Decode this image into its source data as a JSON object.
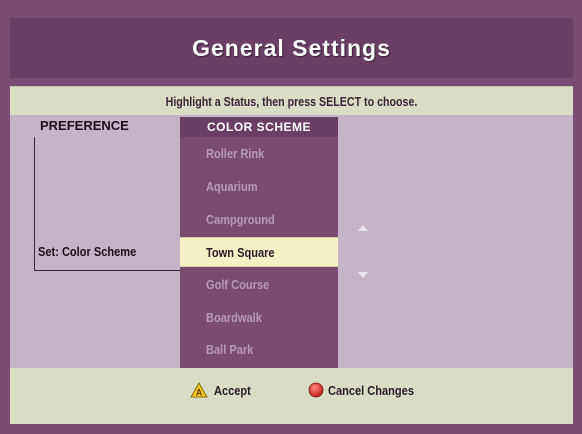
{
  "window": {
    "title": "General Settings",
    "instruction": "Highlight a Status, then press SELECT to choose."
  },
  "header": {
    "preference_label": "PREFERENCE",
    "column_label": "COLOR SCHEME"
  },
  "setting": {
    "label": "Set: Color Scheme"
  },
  "options": [
    {
      "label": "Roller Rink",
      "selected": false
    },
    {
      "label": "Aquarium",
      "selected": false
    },
    {
      "label": "Campground",
      "selected": false
    },
    {
      "label": "Town Square",
      "selected": true
    },
    {
      "label": "Golf Course",
      "selected": false
    },
    {
      "label": "Boardwalk",
      "selected": false
    },
    {
      "label": "Ball Park",
      "selected": false
    }
  ],
  "footer": {
    "accept_label": "Accept",
    "cancel_label": "Cancel Changes",
    "accept_icon": "yellow-triangle-a-icon",
    "cancel_icon": "red-circle-icon"
  },
  "colors": {
    "frame": "#7a4c73",
    "title_bar": "#6a3e66",
    "panel": "#c6b3c8",
    "bar": "#d8ddc4",
    "highlight": "#f4f1c6",
    "accept": "#f2c81e",
    "cancel": "#d9322e"
  }
}
